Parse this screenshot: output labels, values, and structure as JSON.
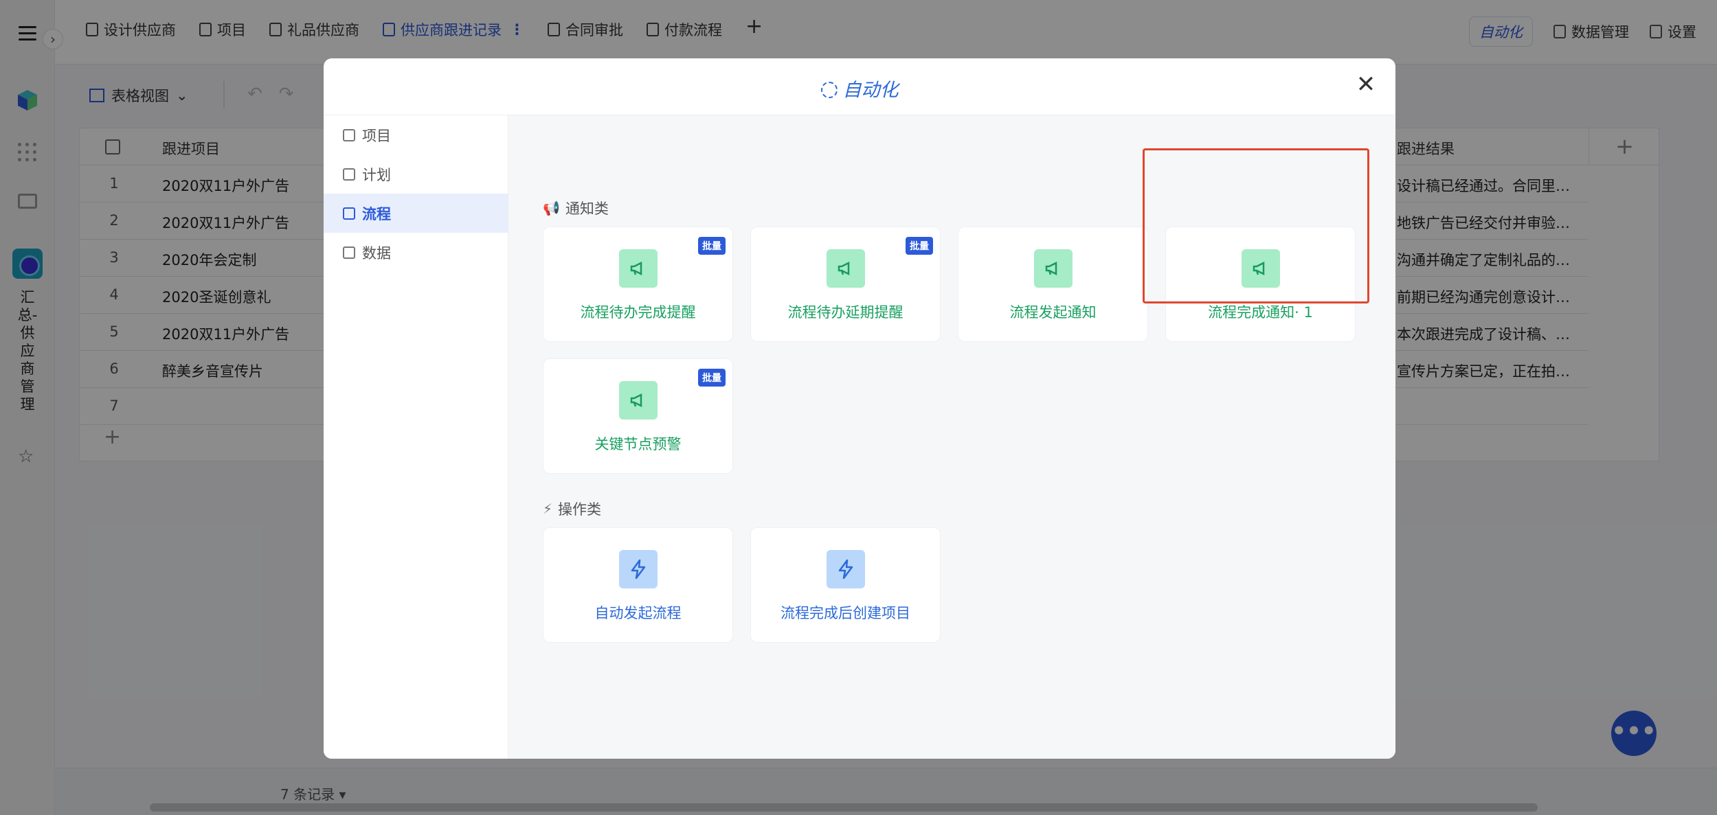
{
  "tabs": [
    {
      "label": "设计供应商",
      "active": false,
      "icon": "doc-icon"
    },
    {
      "label": "项目",
      "active": false,
      "icon": "kanban-icon"
    },
    {
      "label": "礼品供应商",
      "active": false,
      "icon": "doc-icon"
    },
    {
      "label": "供应商跟进记录",
      "active": true,
      "icon": "doc-icon"
    },
    {
      "label": "合同审批",
      "active": false,
      "icon": "flow-icon"
    },
    {
      "label": "付款流程",
      "active": false,
      "icon": "flow-icon"
    }
  ],
  "topright": {
    "automation": "自动化",
    "data_manage": "数据管理",
    "settings": "设置"
  },
  "sidebar": {
    "app_name": "汇总-供应商管理"
  },
  "toolbar": {
    "view_label": "表格视图"
  },
  "table": {
    "col_title": "跟进项目",
    "col_result": "跟进结果",
    "rows": [
      {
        "num": "1",
        "name": "2020双11户外广告",
        "result": "设计稿已经通过。合同里…"
      },
      {
        "num": "2",
        "name": "2020双11户外广告",
        "result": "地铁广告已经交付并审验…"
      },
      {
        "num": "3",
        "name": "2020年会定制",
        "result": "沟通并确定了定制礼品的…"
      },
      {
        "num": "4",
        "name": "2020圣诞创意礼",
        "result": "前期已经沟通完创意设计…"
      },
      {
        "num": "5",
        "name": "2020双11户外广告",
        "result": "本次跟进完成了设计稿、…"
      },
      {
        "num": "6",
        "name": "醉美乡音宣传片",
        "result": "宣传片方案已定，正在拍…"
      },
      {
        "num": "7",
        "name": "",
        "result": ""
      }
    ]
  },
  "footer": {
    "record_count": "7 条记录"
  },
  "modal": {
    "title": "自动化",
    "side_items": [
      {
        "label": "项目",
        "active": false
      },
      {
        "label": "计划",
        "active": false
      },
      {
        "label": "流程",
        "active": true
      },
      {
        "label": "数据",
        "active": false
      }
    ],
    "notify_section": "通知类",
    "action_section": "操作类",
    "notify_cards": [
      {
        "label": "流程待办完成提醒",
        "badge": "批量"
      },
      {
        "label": "流程待办延期提醒",
        "badge": "批量"
      },
      {
        "label": "流程发起通知",
        "badge": ""
      },
      {
        "label": "流程完成通知· 1",
        "badge": ""
      },
      {
        "label": "关键节点预警",
        "badge": "批量"
      }
    ],
    "action_cards": [
      {
        "label": "自动发起流程"
      },
      {
        "label": "流程完成后创建项目"
      }
    ]
  },
  "colors": {
    "accent": "#2c5ad8",
    "notify_green": "#18a060",
    "highlight_red": "#e2452f"
  }
}
